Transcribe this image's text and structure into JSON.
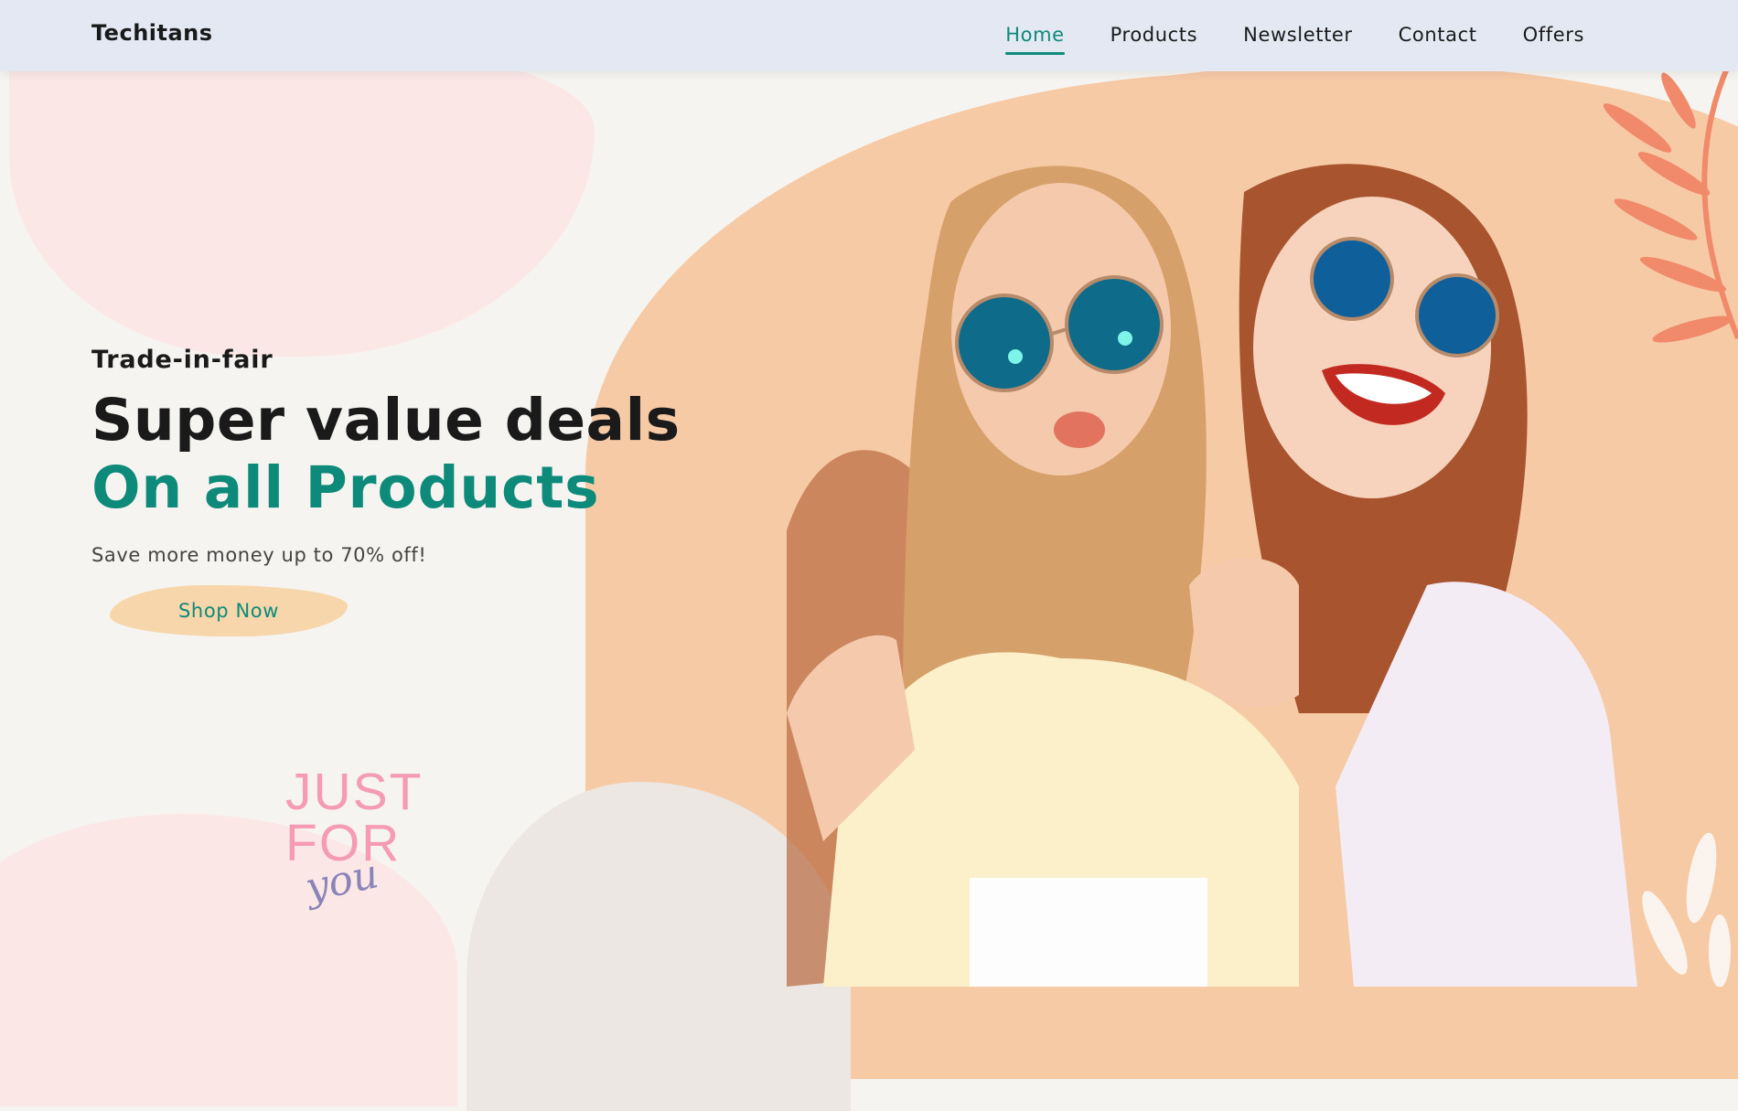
{
  "brand": "Techitans",
  "nav": {
    "items": [
      {
        "label": "Home",
        "active": true
      },
      {
        "label": "Products",
        "active": false
      },
      {
        "label": "Newsletter",
        "active": false
      },
      {
        "label": "Contact",
        "active": false
      },
      {
        "label": "Offers",
        "active": false
      }
    ]
  },
  "hero": {
    "eyebrow": "Trade-in-fair",
    "headline": "Super value deals",
    "headline_accent": "On all Products",
    "subtext": "Save more money up to 70% off!",
    "cta_label": "Shop Now"
  },
  "badge": {
    "line1": "JUST",
    "line2": "FOR",
    "line3": "you"
  },
  "colors": {
    "accent": "#0d8a7a",
    "nav_bg": "#e3e8f3",
    "peach": "#f7caa6",
    "pink": "#fbe8e6",
    "cta_bg": "#f6d6aa",
    "leaf": "#f08a6a"
  }
}
